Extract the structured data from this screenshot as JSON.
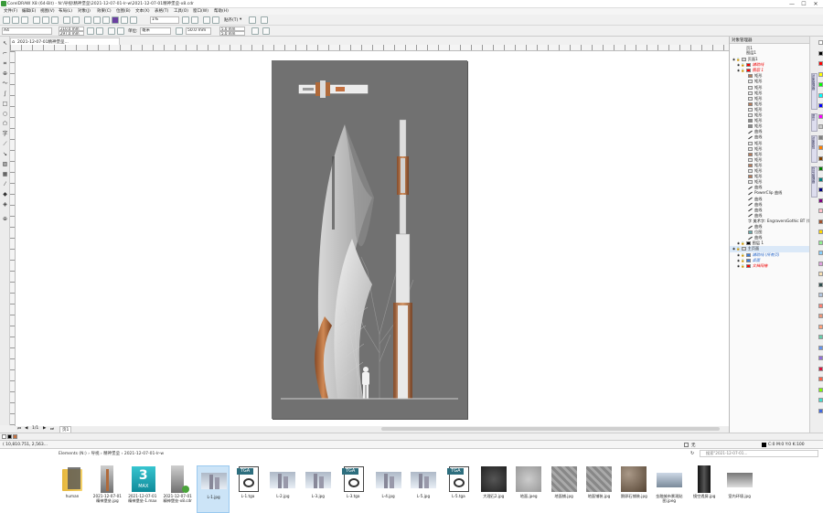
{
  "window": {
    "title": "CorelDRAW X8 (64-Bit) - N:\\导视\\精神堡垒\\2021-12-07-01-lr-w\\2021-12-07-01精神堡垒-x8.cdr",
    "controls": [
      "—",
      "☐",
      "✕"
    ]
  },
  "menu": [
    "文件(F)",
    "编辑(E)",
    "视图(V)",
    "布局(L)",
    "对象(J)",
    "效果(C)",
    "位图(B)",
    "文本(X)",
    "表格(T)",
    "工具(O)",
    "窗口(W)",
    "帮助(H)"
  ],
  "toolbar": {
    "zoom": "1%",
    "snap_label": "贴齐(T)",
    "snap_arrow": "▾"
  },
  "propbar": {
    "page_size": "A4",
    "width": "210.0 mm",
    "height": "297.0 mm",
    "units_label": "单位:",
    "units": "毫米",
    "nudge": ".1 mm",
    "dup1": "5.0 mm",
    "dup2": "5.0 mm",
    "offset": "50.0 mm"
  },
  "document": {
    "tab_title": "2021-12-07-01精神堡垒..."
  },
  "page_nav": {
    "pages": [
      "1/1"
    ],
    "page_tab": "页1"
  },
  "object_manager": {
    "title": "对象管理器",
    "page": "页1",
    "layer_page": "图层1",
    "rows": [
      {
        "label": "页面1",
        "kind": "page"
      },
      {
        "label": "辅助线",
        "kind": "layer",
        "color": "#ff0000"
      },
      {
        "label": "图层 1",
        "kind": "layer",
        "color": "#ff0000"
      },
      {
        "label": "矩形",
        "kind": "rect",
        "fill": "#b87b5a"
      },
      {
        "label": "矩形",
        "kind": "rect",
        "fill": "#e8e8e8"
      },
      {
        "label": "矩形",
        "kind": "rect",
        "fill": "#e8e8e8"
      },
      {
        "label": "矩形",
        "kind": "rect",
        "fill": "#e8e8e8"
      },
      {
        "label": "矩形",
        "kind": "rect",
        "fill": "#e8e8e8"
      },
      {
        "label": "矩形",
        "kind": "rect",
        "fill": "#b87b5a"
      },
      {
        "label": "矩形",
        "kind": "rect",
        "fill": "#e8e8e8"
      },
      {
        "label": "矩形",
        "kind": "rect",
        "fill": "#e8e8e8"
      },
      {
        "label": "矩形",
        "kind": "rect",
        "fill": "#8a8a8a"
      },
      {
        "label": "矩形",
        "kind": "rect",
        "fill": "#8a8a8a"
      },
      {
        "label": "曲线",
        "kind": "curve"
      },
      {
        "label": "曲线",
        "kind": "curve"
      },
      {
        "label": "矩形",
        "kind": "rect",
        "fill": "#e8e8e8"
      },
      {
        "label": "矩形",
        "kind": "rect",
        "fill": "#e8e8e8"
      },
      {
        "label": "矩形",
        "kind": "rect",
        "fill": "#b87b5a"
      },
      {
        "label": "矩形",
        "kind": "rect",
        "fill": "#e8e8e8"
      },
      {
        "label": "矩形",
        "kind": "rect",
        "fill": "#b87b5a"
      },
      {
        "label": "矩形",
        "kind": "rect",
        "fill": "#e8e8e8"
      },
      {
        "label": "矩形",
        "kind": "rect",
        "fill": "#b87b5a"
      },
      {
        "label": "矩形",
        "kind": "rect",
        "fill": "#e8e8e8"
      },
      {
        "label": "曲线",
        "kind": "curve"
      },
      {
        "label": "PowerClip 曲线",
        "kind": "curve"
      },
      {
        "label": "曲线",
        "kind": "curve"
      },
      {
        "label": "曲线",
        "kind": "curve"
      },
      {
        "label": "曲线",
        "kind": "curve"
      },
      {
        "label": "曲线",
        "kind": "curve"
      },
      {
        "label": "美术字: EngraversGothic BT (常",
        "kind": "text"
      },
      {
        "label": "曲线",
        "kind": "curve"
      },
      {
        "label": "位图",
        "kind": "bitmap"
      },
      {
        "label": "曲线",
        "kind": "curve"
      },
      {
        "label": "图层 1",
        "kind": "layer",
        "color": "#000000"
      },
      {
        "label": "主页面",
        "kind": "page",
        "selected": true
      },
      {
        "label": "辅助线 (所有页)",
        "kind": "layer",
        "color": "#3b7ddd"
      },
      {
        "label": "桌面",
        "kind": "layer",
        "color": "#3b7ddd"
      },
      {
        "label": "文档网格",
        "kind": "layer",
        "color": "#ff0000"
      }
    ]
  },
  "docker_tabs": [
    "对象管理器",
    "提示",
    "对象属性",
    "符号管理器"
  ],
  "status": {
    "coords": "( 10,810.751, 2,563...",
    "fill": "C:0 M:0 Y:0 K:100",
    "fill_none": "无"
  },
  "explorer": {
    "path": [
      "Elements (N:)",
      "导视",
      "精神堡垒",
      "2021-12-07-01-lr-w"
    ],
    "search_placeholder": "搜索\"2021-12-07-01...",
    "files": [
      {
        "name": "human",
        "type": "folder"
      },
      {
        "name": "2021-12-07-01 精神堡垒.jpg",
        "type": "render"
      },
      {
        "name": "2021-12-07-01 精神堡垒-1.max",
        "type": "max"
      },
      {
        "name": "2021-12-07-01 精神堡垒-x8.cdr",
        "type": "cdr"
      },
      {
        "name": "L-1.jpg",
        "type": "sky",
        "selected": true
      },
      {
        "name": "L-1.tga",
        "type": "tga"
      },
      {
        "name": "L-2.jpg",
        "type": "sky"
      },
      {
        "name": "L-3.jpg",
        "type": "sky"
      },
      {
        "name": "L-3.tga",
        "type": "tga"
      },
      {
        "name": "L-4.jpg",
        "type": "sky"
      },
      {
        "name": "L-5.jpg",
        "type": "sky"
      },
      {
        "name": "L-5.tga",
        "type": "tga"
      },
      {
        "name": "大理石2.jpg",
        "type": "marble"
      },
      {
        "name": "地面.jpeg",
        "type": "stone"
      },
      {
        "name": "地面铺.jpg",
        "type": "stone2"
      },
      {
        "name": "地面铺装.jpg",
        "type": "stone2"
      },
      {
        "name": "鹅卵石铺装.jpg",
        "type": "pebble"
      },
      {
        "name": "金融城市景观贴图.jpeg",
        "type": "city"
      },
      {
        "name": "镜空透屏.jpg",
        "type": "dark"
      },
      {
        "name": "室内环境.jpg",
        "type": "room"
      }
    ]
  },
  "colors": {
    "accent": "#c4703f",
    "copper": "#b06a3a",
    "page_bg": "#717171",
    "selection": "#cce4f7"
  },
  "palette": [
    "#ffffff",
    "#000000",
    "#ff0000",
    "#ffff00",
    "#00ff00",
    "#00ffff",
    "#0000ff",
    "#ff00ff",
    "#c8c8c8",
    "#808080",
    "#ff8000",
    "#804000",
    "#008000",
    "#008080",
    "#000080",
    "#800080",
    "#ffc0cb",
    "#a0522d",
    "#ffd700",
    "#90ee90",
    "#87cefa",
    "#dda0dd",
    "#f5deb3",
    "#2f4f4f",
    "#b0c4de",
    "#fa8072",
    "#e9967a",
    "#ffa07a",
    "#66cdaa",
    "#6495ed",
    "#9370db",
    "#dc143c",
    "#ff6347",
    "#7cfc00",
    "#40e0d0",
    "#4169e1"
  ]
}
